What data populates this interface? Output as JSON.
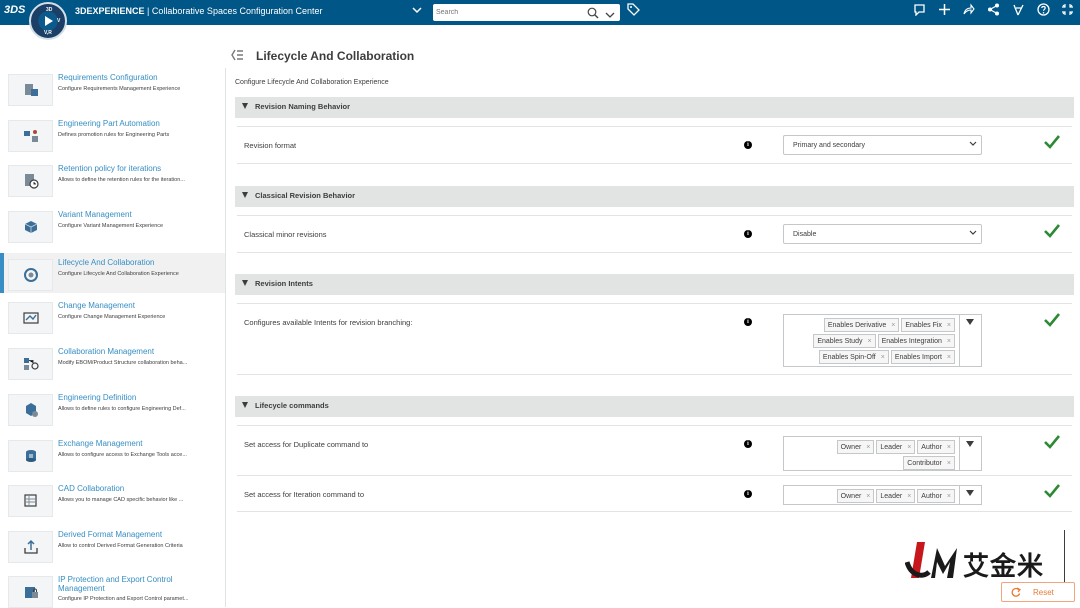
{
  "topbar": {
    "brand": "3DS",
    "compass": {
      "north": "3D",
      "east": "V",
      "south": "V,R"
    },
    "app_name": "3DEXPERIENCE",
    "separator": "|",
    "app_title": "Collaborative Spaces Configuration Center",
    "search_placeholder": "Search",
    "icons": [
      "chevron-down-icon",
      "search-icon",
      "chevron-down-icon",
      "tag-icon",
      "feed-icon",
      "plus-icon",
      "share-icon",
      "network-icon",
      "compass-tools-icon",
      "help-icon",
      "fullscreen-icon"
    ],
    "bar_color": "#005686"
  },
  "sidebar": {
    "accent": "#368ec4",
    "items": [
      {
        "title": "Requirements Configuration",
        "desc": "Configure Requirements Management Experience",
        "icon": "requirements-icon"
      },
      {
        "title": "Engineering Part Automation",
        "desc": "Defines promotion rules for Engineering Parts",
        "icon": "part-automation-icon"
      },
      {
        "title": "Retention policy for iterations",
        "desc": "Allows to define the retention rules for the iteration...",
        "icon": "retention-icon"
      },
      {
        "title": "Variant Management",
        "desc": "Configure Variant Management Experience",
        "icon": "variant-icon"
      },
      {
        "title": "Lifecycle And Collaboration",
        "desc": "Configure Lifecycle And Collaboration Experience",
        "icon": "lifecycle-icon",
        "active": true
      },
      {
        "title": "Change Management",
        "desc": "Configure Change Management Experience",
        "icon": "change-icon"
      },
      {
        "title": "Collaboration Management",
        "desc": "Modify EBOM/Product Structure collaboration beha...",
        "icon": "collaboration-icon"
      },
      {
        "title": "Engineering Definition",
        "desc": "Allows to define rules to configure Engineering Def...",
        "icon": "engineering-definition-icon"
      },
      {
        "title": "Exchange Management",
        "desc": "Allows to configure access to Exchange Tools acce...",
        "icon": "exchange-icon"
      },
      {
        "title": "CAD Collaboration",
        "desc": "Allows you to manage CAD specific behavior like ...",
        "icon": "cad-icon"
      },
      {
        "title": "Derived Format Management",
        "desc": "Allow to control Derived Format Generation Criteria",
        "icon": "derived-format-icon"
      },
      {
        "title": "IP Protection and Export Control Management",
        "desc": "Configure IP Protection and Export Control paramet...",
        "icon": "ip-protection-icon"
      }
    ]
  },
  "main": {
    "title": "Lifecycle And Collaboration",
    "subtitle": "Configure Lifecycle And Collaboration Experience",
    "sections": [
      {
        "label": "Revision Naming Behavior"
      },
      {
        "label": "Classical Revision Behavior"
      },
      {
        "label": "Revision Intents"
      },
      {
        "label": "Lifecycle commands"
      }
    ],
    "rows": {
      "revision_format": {
        "label": "Revision format",
        "value": "Primary and secondary"
      },
      "classical_minor": {
        "label": "Classical minor revisions",
        "value": "Disable"
      },
      "intents": {
        "label": "Configures available Intents for revision branching:",
        "chips": [
          "Enables Derivative",
          "Enables Fix",
          "Enables Study",
          "Enables Integration",
          "Enables Spin-Off",
          "Enables Import"
        ]
      },
      "duplicate": {
        "label": "Set access for Duplicate command to",
        "chips": [
          "Owner",
          "Leader",
          "Author",
          "Contributor"
        ]
      },
      "iteration": {
        "label": "Set access for Iteration command to",
        "chips": [
          "Owner",
          "Leader",
          "Author"
        ]
      }
    },
    "check_color": "#2d8a34",
    "info_glyph": "i",
    "chip_remove": "×"
  },
  "watermark": {
    "logo": "IJM",
    "text": "艾金米"
  },
  "reset": {
    "label": "Reset",
    "color": "#e87a35"
  }
}
